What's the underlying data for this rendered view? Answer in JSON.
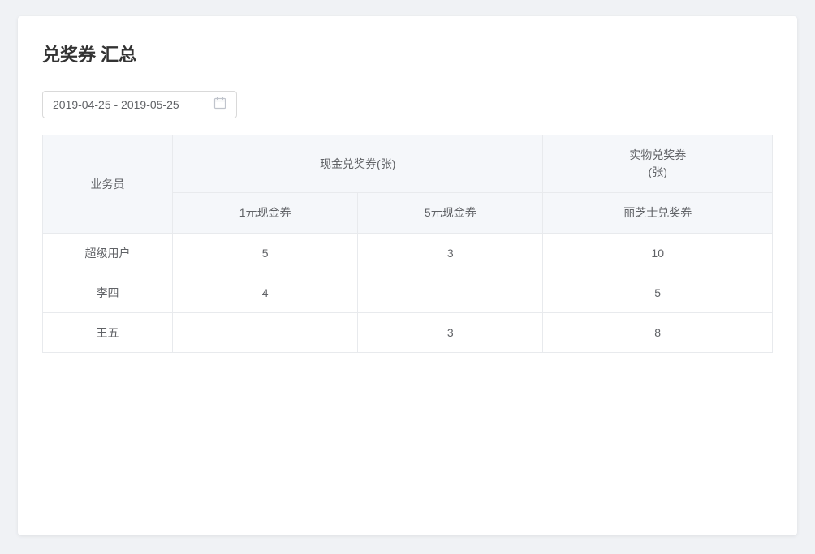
{
  "page": {
    "title": "兑奖券 汇总"
  },
  "datepicker": {
    "value": "2019-04-25 - 2019-05-25",
    "icon": "📅"
  },
  "table": {
    "headers": {
      "salesperson": "业务员",
      "cash_voucher_group": "现金兑奖券(张)",
      "physical_voucher_group": "实物兑奖券\n(张)",
      "col1_yuan": "1元现金券",
      "col5_yuan": "5元现金券",
      "col_lizhi": "丽芝士兑奖券"
    },
    "rows": [
      {
        "salesperson": "超级用户",
        "col1_yuan": "5",
        "col5_yuan": "3",
        "col_lizhi": "10"
      },
      {
        "salesperson": "李四",
        "col1_yuan": "4",
        "col5_yuan": "",
        "col_lizhi": "5"
      },
      {
        "salesperson": "王五",
        "col1_yuan": "",
        "col5_yuan": "3",
        "col_lizhi": "8"
      }
    ]
  }
}
